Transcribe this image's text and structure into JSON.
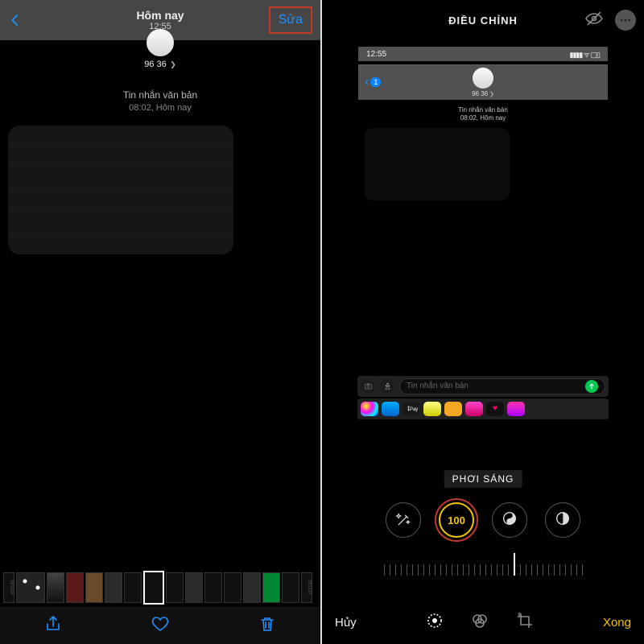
{
  "left": {
    "title": "Hôm nay",
    "time": "12:55",
    "edit": "Sửa",
    "sender": "96 36",
    "msg_type": "Tin nhắn văn bản",
    "msg_time": "08:02, Hôm nay",
    "thumb_brand": "BISOF"
  },
  "right": {
    "title": "ĐIỀU CHỈNH",
    "status_time": "12:55",
    "back_badge": "1",
    "sender": "96 36",
    "msg_type": "Tin nhắn văn bản",
    "msg_time": "08:02, Hôm nay",
    "input_placeholder": "Tin nhắn văn bản",
    "apple_pay": "【Pay",
    "tool_label": "PHƠI SÁNG",
    "exposure_value": "100",
    "cancel": "Hủy",
    "done": "Xong"
  }
}
